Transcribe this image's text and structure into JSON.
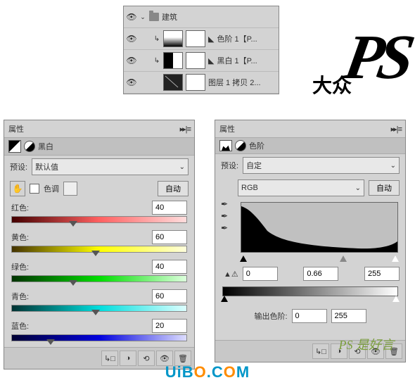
{
  "layers": {
    "group_name": "建筑",
    "items": [
      {
        "name": "色阶 1【P..."
      },
      {
        "name": "黑白 1【P..."
      },
      {
        "name": "图层 1 拷贝 2..."
      }
    ]
  },
  "bw_panel": {
    "tab": "属性",
    "title": "黑白",
    "preset_label": "预设:",
    "preset_value": "默认值",
    "tint_label": "色调",
    "auto_label": "自动",
    "sliders": [
      {
        "label": "红色:",
        "value": "40",
        "pos": 35,
        "grad": "grad-red"
      },
      {
        "label": "黄色:",
        "value": "60",
        "pos": 48,
        "grad": "grad-yellow"
      },
      {
        "label": "绿色:",
        "value": "40",
        "pos": 35,
        "grad": "grad-green"
      },
      {
        "label": "青色:",
        "value": "60",
        "pos": 48,
        "grad": "grad-cyan"
      },
      {
        "label": "蓝色:",
        "value": "20",
        "pos": 22,
        "grad": "grad-blue"
      }
    ]
  },
  "levels_panel": {
    "tab": "属性",
    "title": "色阶",
    "preset_label": "预设:",
    "preset_value": "自定",
    "channel": "RGB",
    "auto_label": "自动",
    "input_levels": {
      "black": "0",
      "gamma": "0.66",
      "white": "255"
    },
    "output_label": "输出色阶:",
    "output": {
      "black": "0",
      "white": "255"
    }
  },
  "watermark_main": "PS",
  "watermark_sub": "大众",
  "brand": {
    "p1": "Ui",
    "p2": "B",
    "dot": "O",
    "p3": ".C",
    "dot2": "O",
    "p4": "M"
  },
  "sahao": "PS 是好言"
}
